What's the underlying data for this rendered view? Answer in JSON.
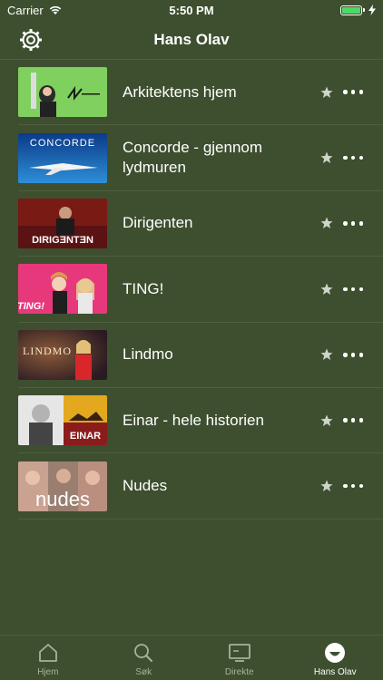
{
  "status_bar": {
    "carrier": "Carrier",
    "time": "5:50 PM"
  },
  "nav": {
    "title": "Hans Olav"
  },
  "items": [
    {
      "title": "Arkitektens hjem",
      "thumb_icon": "arkitektens-hjem-thumbnail"
    },
    {
      "title": "Concorde - gjennom lydmuren",
      "thumb_icon": "concorde-thumbnail",
      "thumb_text": "CONCORDE"
    },
    {
      "title": "Dirigenten",
      "thumb_icon": "dirigenten-thumbnail",
      "thumb_text": "DIRIGƎNTƎN"
    },
    {
      "title": "TING!",
      "thumb_icon": "ting-thumbnail",
      "thumb_text": "TING!"
    },
    {
      "title": "Lindmo",
      "thumb_icon": "lindmo-thumbnail",
      "thumb_text": "LINDMO"
    },
    {
      "title": "Einar - hele historien",
      "thumb_icon": "einar-thumbnail",
      "thumb_text": "EINAR"
    },
    {
      "title": "Nudes",
      "thumb_icon": "nudes-thumbnail",
      "thumb_text": "nudes"
    }
  ],
  "tabs": [
    {
      "label": "Hjem",
      "icon": "home-icon",
      "active": false
    },
    {
      "label": "Søk",
      "icon": "search-icon",
      "active": false
    },
    {
      "label": "Direkte",
      "icon": "tv-icon",
      "active": false
    },
    {
      "label": "Hans Olav",
      "icon": "profile-icon",
      "active": true
    }
  ],
  "colors": {
    "background": "#3e4f2f",
    "separator": "#4e5f3f",
    "inactive_tab": "#a8b29c",
    "battery": "#4cd964"
  }
}
